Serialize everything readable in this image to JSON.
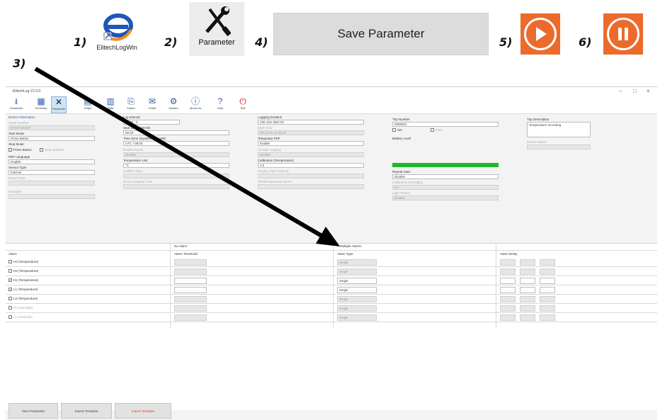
{
  "legend": {
    "step1_label": "1)",
    "step2_label": "2)",
    "step3_label": "3)",
    "step4_label": "4)",
    "step5_label": "5)",
    "step6_label": "6)",
    "app_icon_caption": "ElitechLogWin",
    "parameter_caption": "Parameter",
    "save_parameter_label": "Save Parameter",
    "accent_orange": "#ec6a2c",
    "arrow_color": "#000000"
  },
  "window": {
    "title": "ElitechLog V1.0.0",
    "controls": [
      "–",
      "□",
      "×"
    ]
  },
  "toolbar": {
    "items": [
      {
        "label": "Download",
        "icon": "download-icon"
      },
      {
        "label": "Summary",
        "icon": "summary-icon"
      },
      {
        "label": "Parameter",
        "icon": "parameter-icon"
      },
      {
        "label": "Graph",
        "icon": "graph-icon"
      },
      {
        "label": "Data",
        "icon": "data-icon"
      },
      {
        "label": "Import",
        "icon": "import-icon"
      },
      {
        "label": "Email",
        "icon": "email-icon"
      },
      {
        "label": "System",
        "icon": "system-icon"
      },
      {
        "label": "About Us",
        "icon": "info-icon"
      },
      {
        "label": "Help",
        "icon": "help-icon"
      },
      {
        "label": "Exit",
        "icon": "power-icon"
      }
    ]
  },
  "device_info": {
    "section_title": "Device Information",
    "serial_label": "Serial Number",
    "serial_value": "EF207100237",
    "start_mode_label": "Start Mode",
    "start_mode_value": "Press Button",
    "stop_mode_label": "Stop Mode",
    "stop_mode_press_button": "Press Button",
    "stop_mode_software": "Stop Software",
    "pdf_language_label": "PDF Language",
    "pdf_language_value": "English",
    "sensor_type_label": "Sensor Type",
    "sensor_type_value": "Internal",
    "button_tone_label": "Button Tone",
    "backlight_label": "Backlight"
  },
  "col2": {
    "log_interval_label": "Log Interval",
    "log_interval_value": "0 : 15 : 0",
    "start_delay_label": "Start Delay (HH:M)",
    "start_delay_value": "00:00",
    "time_zone_label": "Time Zone (System: UTC+08)",
    "time_zone_value": "UTC +08:00",
    "enable_pause_label": "Enable Pause",
    "enable_pause_value": "Disable",
    "temperature_unit_label": "Temperature Unit",
    "temperature_unit_value": "°C",
    "audible_alarm_label": "Audible Alarm",
    "screen_display_label": "Screen Display Time"
  },
  "col3": {
    "logging_duration_label": "Logging Duration",
    "logging_duration_value": "045 15H 30M 0S",
    "start_time_label": "Start Time",
    "start_time_value": "09-12-29 15:40:40",
    "temporary_pdf_label": "Temporary PDF",
    "temporary_pdf_value": "Enable",
    "circular_logging_label": "Circular Logging",
    "circular_logging_value": "Disable",
    "calibration_label": "Calibration (Temperature)",
    "calibration_value": "0.0",
    "display_alarm_label": "Display Alarm Interval",
    "hpm_label": "HPM/temperature alarm"
  },
  "col4": {
    "trip_number_label": "Trip Number",
    "trip_number_value": "0000001",
    "set_label": "Set",
    "c2h_label": "C2H",
    "battery_level_label": "Battery Level",
    "battery_color": "#1fb82c",
    "repeat_start_label": "Repeat Start",
    "repeat_start_value": "Disable",
    "calibration_humidity_label": "Calibration (Humidity)",
    "calibration_humidity_value": "0.0",
    "light_sensor_label": "Light Sensor",
    "light_sensor_value": "Disable"
  },
  "col5": {
    "trip_description_label": "Trip Description",
    "trip_description_value": "Temperature recording",
    "device_name_label": "Device Name"
  },
  "alarm": {
    "no_alarm_label": "No Alarm",
    "multiple_alarms_label": "Multiple Alarms",
    "headers": [
      "Alarm",
      "Alarm Threshold",
      "Alarm Type",
      "Alarm Delay"
    ],
    "rows": [
      {
        "name": "H3 (Temperature)",
        "type": "Single",
        "checked": false,
        "enabled": true,
        "active": false
      },
      {
        "name": "H2 (Temperature)",
        "type": "Single",
        "checked": false,
        "enabled": true,
        "active": false
      },
      {
        "name": "H1 (Temperature)",
        "type": "Single",
        "checked": true,
        "enabled": true,
        "active": true
      },
      {
        "name": "L1 (Temperature)",
        "type": "Single",
        "checked": true,
        "enabled": true,
        "active": true
      },
      {
        "name": "L2 (Temperature)",
        "type": "Single",
        "checked": false,
        "enabled": true,
        "active": false
      },
      {
        "name": "H1 (Humidity)",
        "type": "Single",
        "checked": false,
        "enabled": false,
        "active": false
      },
      {
        "name": "L1 (Humidity)",
        "type": "Single",
        "checked": false,
        "enabled": false,
        "active": false
      }
    ]
  },
  "footer": {
    "save_parameter": "Save Parameter",
    "export_template": "Export Template",
    "import_template": "Import Template"
  }
}
